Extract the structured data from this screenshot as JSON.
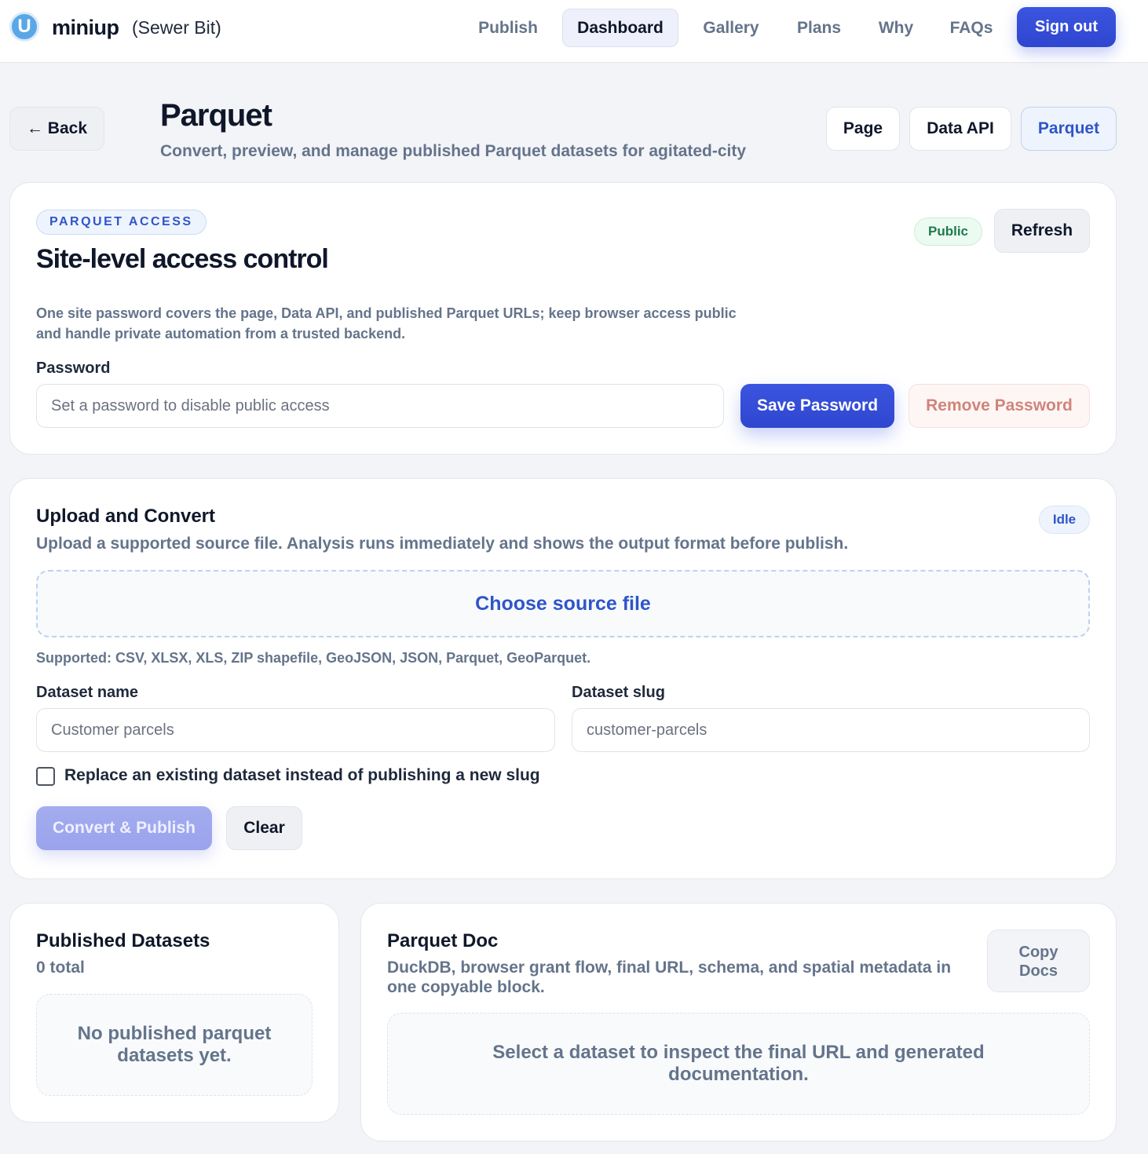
{
  "nav": {
    "logo_letter": "U",
    "brand": "miniup",
    "account": "(Sewer Bit)",
    "items": [
      "Publish",
      "Dashboard",
      "Gallery",
      "Plans",
      "Why",
      "FAQs"
    ],
    "active": "Dashboard",
    "signout": "Sign out"
  },
  "header": {
    "back": "← Back",
    "title": "Parquet",
    "subtitle": "Convert, preview, and manage published Parquet datasets for agitated-city",
    "tabs": [
      "Page",
      "Data API",
      "Parquet"
    ],
    "active_tab": "Parquet"
  },
  "access": {
    "eyebrow": "PARQUET ACCESS",
    "title": "Site-level access control",
    "status_badge": "Public",
    "refresh": "Refresh",
    "description_line1": "One site password covers the page, Data API, and published Parquet URLs; keep browser access public",
    "description_line2": "and handle private automation from a trusted backend.",
    "password_label": "Password",
    "password_placeholder": "Set a password to disable public access",
    "save_button": "Save Password",
    "remove_button": "Remove Password"
  },
  "upload": {
    "title": "Upload and Convert",
    "subtitle": "Upload a supported source file. Analysis runs immediately and shows the output format before publish.",
    "status_badge": "Idle",
    "choose_file": "Choose source file",
    "supported": "Supported: CSV, XLSX, XLS, ZIP shapefile, GeoJSON, JSON, Parquet, GeoParquet.",
    "name_label": "Dataset name",
    "name_placeholder": "Customer parcels",
    "slug_label": "Dataset slug",
    "slug_placeholder": "customer-parcels",
    "replace_checkbox": "Replace an existing dataset instead of publishing a new slug",
    "convert_button": "Convert & Publish",
    "clear_button": "Clear"
  },
  "datasets": {
    "title": "Published Datasets",
    "count": "0 total",
    "empty_line1": "No published parquet",
    "empty_line2": "datasets yet."
  },
  "docs": {
    "title": "Parquet Doc",
    "subtitle_line1": "DuckDB, browser grant flow, final URL, schema, and spatial metadata in",
    "subtitle_line2": "one copyable block.",
    "copy_line1": "Copy",
    "copy_line2": "Docs",
    "empty_line1": "Select a dataset to inspect the final URL and generated",
    "empty_line2": "documentation."
  },
  "colors": {
    "accent": "#2f46cf",
    "link": "#2f55c9",
    "public_badge": "#1f7a4d",
    "danger_text": "#d0847a"
  }
}
